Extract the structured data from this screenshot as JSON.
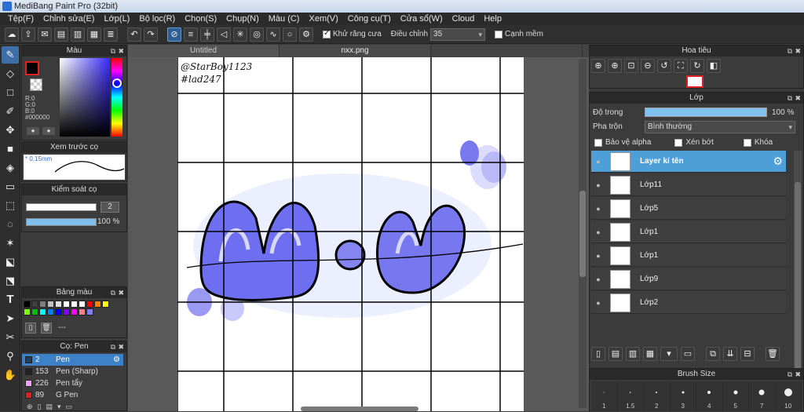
{
  "title": "MediBang Paint Pro (32bit)",
  "menu": [
    "Tệp(F)",
    "Chỉnh sửa(E)",
    "Lớp(L)",
    "Bộ lọc(R)",
    "Chọn(S)",
    "Chụp(N)",
    "Màu (C)",
    "Xem(V)",
    "Công cụ(T)",
    "Cửa sổ(W)",
    "Cloud",
    "Help"
  ],
  "toolbar": {
    "antialias_label": "Khử răng cưa",
    "adjust_label": "Điều chỉnh",
    "adjust_value": "35",
    "edge_label": "Cạnh mềm"
  },
  "color_panel": {
    "title": "Màu",
    "r": "R:0",
    "g": "G:0",
    "b": "B:0",
    "hex": "#000000",
    "primary": "#000000"
  },
  "brush_preview": {
    "title": "Xem trước cọ",
    "size": "0.15mm"
  },
  "brush_control": {
    "title": "Kiểm soát cọ",
    "size": "2",
    "opacity": "100 %"
  },
  "palette": {
    "title": "Bảng màu",
    "colors": [
      "#000000",
      "#404040",
      "#808080",
      "#c0c0c0",
      "#e0e0e0",
      "#ffffff",
      "#ffffff",
      "#ffffff",
      "#ff0000",
      "#ff8000",
      "#ffff00",
      "#80ff00",
      "#00c000",
      "#00ffff",
      "#0080ff",
      "#0000ff",
      "#8000ff",
      "#ff00ff",
      "#ff8080",
      "#8080ff"
    ],
    "name": "---"
  },
  "brush_panel": {
    "title": "Cọ: Pen",
    "items": [
      {
        "num": "2",
        "name": "Pen",
        "color": "#1e3e66",
        "selected": true
      },
      {
        "num": "153",
        "name": "Pen (Sharp)",
        "color": "#222222",
        "selected": false
      },
      {
        "num": "226",
        "name": "Pen tẩy",
        "color": "#f4a0ff",
        "selected": false
      },
      {
        "num": "89",
        "name": "G Pen",
        "color": "#e02020",
        "selected": false
      }
    ]
  },
  "tabs": [
    "Untitled",
    "nxx.png"
  ],
  "canvas_text": {
    "line1": "@StarBoy1123",
    "line2": "#lad247"
  },
  "navigator": {
    "title": "Hoa tiêu"
  },
  "layer_panel": {
    "title": "Lớp",
    "opacity_label": "Độ trong",
    "opacity_value": "100 %",
    "blend_label": "Pha trộn",
    "blend_value": "Bình thường",
    "protect_alpha": "Bảo vệ alpha",
    "clip": "Xén bớt",
    "lock": "Khóa",
    "layers": [
      "Layer kí tên",
      "Lớp11",
      "Lớp5",
      "Lớp1",
      "Lớp1",
      "Lớp9",
      "Lớp2"
    ]
  },
  "brush_size": {
    "title": "Brush Size",
    "sizes": [
      "1",
      "1.5",
      "2",
      "3",
      "4",
      "5",
      "7",
      "10"
    ]
  }
}
